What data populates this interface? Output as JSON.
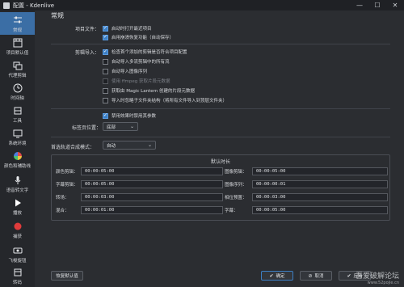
{
  "window": {
    "title": "配置 - Kdenlive",
    "minimize": "—",
    "maximize": "☐",
    "close": "✕"
  },
  "sidebar": {
    "items": [
      {
        "label": "常规",
        "icon": "sliders-icon"
      },
      {
        "label": "项目默认值",
        "icon": "film-icon"
      },
      {
        "label": "代理剪辑",
        "icon": "proxy-icon"
      },
      {
        "label": "时间轴",
        "icon": "timeline-icon"
      },
      {
        "label": "工具",
        "icon": "tools-icon"
      },
      {
        "label": "系统环境",
        "icon": "environment-icon"
      },
      {
        "label": "颜色和辅助线",
        "icon": "color-wheel-icon"
      },
      {
        "label": "语音转文字",
        "icon": "microphone-icon"
      },
      {
        "label": "播放",
        "icon": "play-icon"
      },
      {
        "label": "捕获",
        "icon": "record-icon"
      },
      {
        "label": "飞梭旋钮",
        "icon": "jog-shuttle-icon"
      },
      {
        "label": "转码",
        "icon": "transcode-icon"
      }
    ]
  },
  "general": {
    "section_title": "常规",
    "project_file_label": "项目文件：",
    "open_last_project": "启动时打开最近项目",
    "enable_auto_recovery": "启用崩溃恢复功能（自动保存）",
    "clip_import_label": "剪辑导入：",
    "check_first_clip_profile": "检查首个添加的剪辑是否符合项目配置",
    "auto_import_multistream": "自动导入多流剪辑中的所有流",
    "auto_import_image_sequence": "自动导入图像序列",
    "use_ffmpeg_metadata": "使用 ffmpeg 获取片段元数据",
    "get_magic_lantern_metadata": "获取由 Magic Lantern 创建的片段元数据",
    "import_folder_structure": "导入时忽略子文件夹结构（将所有文件导入到顶层文件夹）",
    "disable_parameters_when_hidden": "禁用效果时禁用其参数",
    "tab_position_label": "标签页位置：",
    "tab_position_value": "底部",
    "preferred_track_compositing_label": "首选轨道合成模式：",
    "preferred_track_compositing_value": "自动"
  },
  "default_durations": {
    "title": "默认时长",
    "color_clip_label": "颜色剪辑：",
    "color_clip_value": "00:00:05:00",
    "image_clip_label": "图像剪辑：",
    "image_clip_value": "00:00:05:00",
    "title_clip_label": "字幕剪辑：",
    "title_clip_value": "00:00:05:00",
    "image_sequence_label": "图像序列：",
    "image_sequence_value": "00:00:00:01",
    "transition_label": "转场：",
    "transition_value": "00:00:03:00",
    "sequence_label": "相位预置：",
    "sequence_value": "00:00:03:00",
    "mix_label": "混合：",
    "mix_value": "00:00:01:00",
    "subtitle_label": "字幕：",
    "subtitle_value": "00:00:05:00"
  },
  "buttons": {
    "restore_defaults": "恢复默认值",
    "ok": "确定",
    "cancel": "取消",
    "apply": "应用"
  },
  "watermark": {
    "line1": "吾爱破解论坛",
    "line2": "www.52pojie.cn"
  }
}
